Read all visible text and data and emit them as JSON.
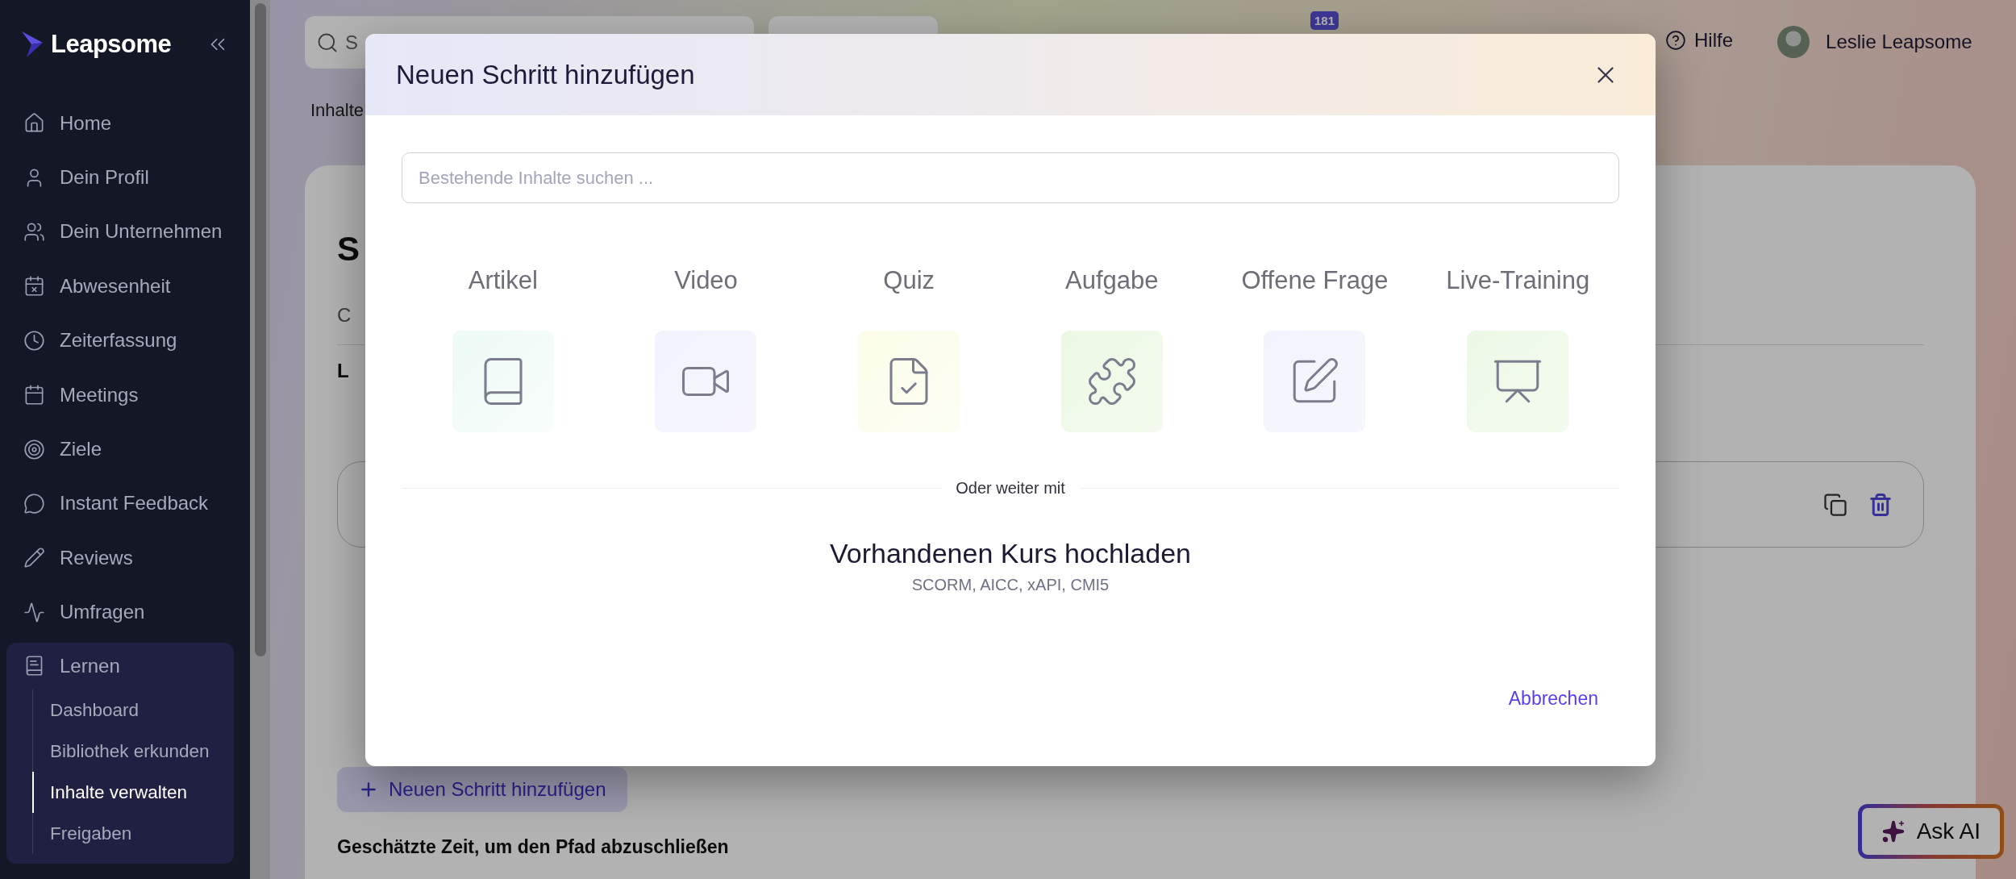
{
  "sidebar": {
    "logo": "Leapsome",
    "items": [
      {
        "label": "Home",
        "selected": false
      },
      {
        "label": "Dein Profil",
        "selected": false
      },
      {
        "label": "Dein Unternehmen",
        "selected": false
      },
      {
        "label": "Abwesenheit",
        "selected": false
      },
      {
        "label": "Zeiterfassung",
        "selected": false
      },
      {
        "label": "Meetings",
        "selected": false
      },
      {
        "label": "Ziele",
        "selected": false
      },
      {
        "label": "Instant Feedback",
        "selected": false
      },
      {
        "label": "Reviews",
        "selected": false
      },
      {
        "label": "Umfragen",
        "selected": false
      },
      {
        "label": "Lernen",
        "selected": true,
        "children": [
          {
            "label": "Dashboard",
            "selected": false
          },
          {
            "label": "Bibliothek erkunden",
            "selected": false
          },
          {
            "label": "Inhalte verwalten",
            "selected": true
          },
          {
            "label": "Freigaben",
            "selected": false
          }
        ]
      }
    ]
  },
  "topbar": {
    "search": {
      "placeholder": "S"
    },
    "notification_count": "181",
    "help": "Hilfe",
    "user_name": "Leslie Leapsome"
  },
  "breadcrumb": "Inhalte",
  "background_card": {
    "heading": "S",
    "tab": "C",
    "section": "L",
    "add_step_button": "Neuen Schritt hinzufügen",
    "estimated_time_label": "Geschätzte Zeit, um den Pfad abzuschließen"
  },
  "modal": {
    "title": "Neuen Schritt hinzufügen",
    "search": {
      "placeholder": "Bestehende Inhalte suchen ..."
    },
    "content_types": [
      {
        "label": "Artikel"
      },
      {
        "label": "Video"
      },
      {
        "label": "Quiz"
      },
      {
        "label": "Aufgabe"
      },
      {
        "label": "Offene Frage"
      },
      {
        "label": "Live-Training"
      }
    ],
    "divider_text": "Oder weiter mit",
    "upload": {
      "title": "Vorhandenen Kurs hochladen",
      "formats": "SCORM, AICC, xAPI, CMI5"
    },
    "cancel": "Abbrechen"
  },
  "ask_ai": "Ask AI"
}
